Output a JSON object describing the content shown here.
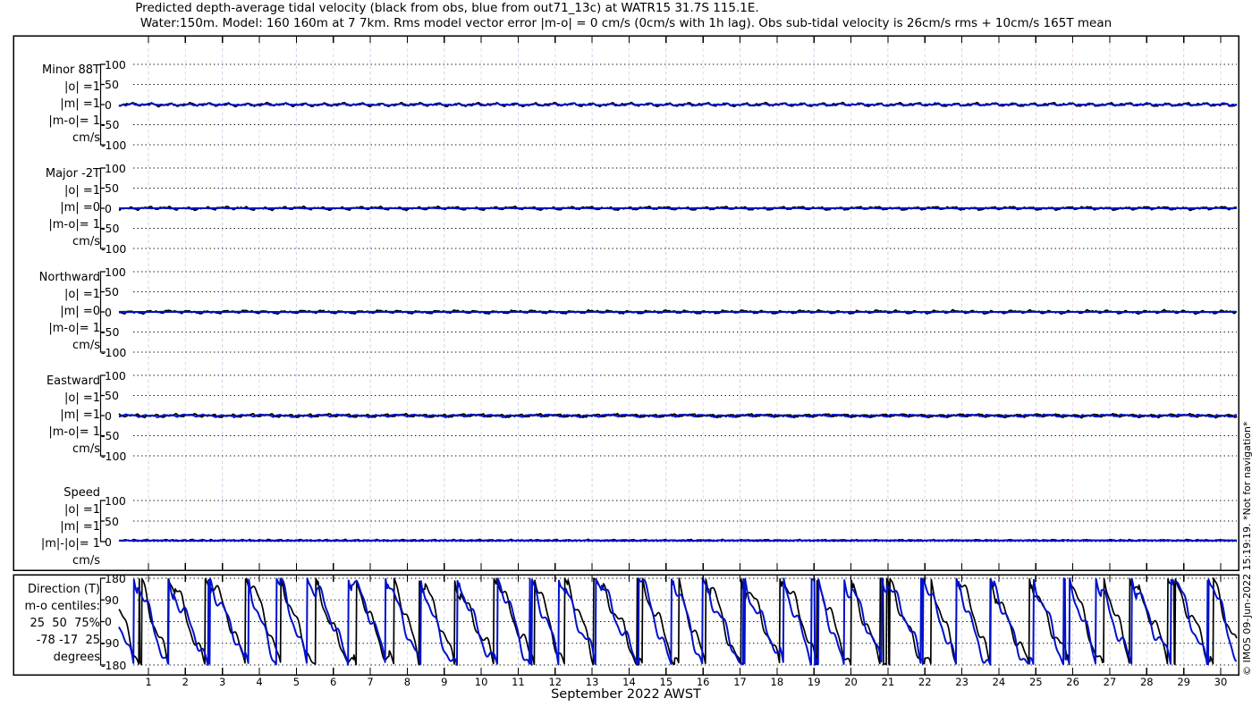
{
  "title": {
    "line1": "Predicted depth-average tidal velocity (black from obs, blue from out71_13c) at WATR15 31.7S 115.1E.",
    "line2": "Water:150m. Model: 160 160m at 7 7km. Rms model vector error |m-o| = 0 cm/s (0cm/s with 1h lag). Obs sub-tidal velocity is 26cm/s rms + 10cm/s 165T mean"
  },
  "watermark": "© IMOS 09-Jun-2022 15:19:19. *Not for navigation*",
  "colors": {
    "obs_line": "#000000",
    "model_line": "#0011cc",
    "day_grid_a": "#ccd4e8",
    "day_grid_b": "#ecd8d8",
    "dotted_grid": "#111111",
    "axis": "#000000"
  },
  "xaxis": {
    "label": "September 2022 AWST",
    "days": [
      "1",
      "2",
      "3",
      "4",
      "5",
      "6",
      "7",
      "8",
      "9",
      "10",
      "11",
      "12",
      "13",
      "14",
      "15",
      "16",
      "17",
      "18",
      "19",
      "20",
      "21",
      "22",
      "23",
      "24",
      "25",
      "26",
      "27",
      "28",
      "29",
      "30"
    ]
  },
  "panels": [
    {
      "id": "minor",
      "label_lines": [
        "Minor 88T",
        "|o| =1",
        "|m| =1",
        "|m-o|= 1",
        "cm/s"
      ],
      "yticks": [
        "100",
        "50",
        "0",
        "-50",
        "-100"
      ]
    },
    {
      "id": "major",
      "label_lines": [
        "Major -2T",
        "|o| =1",
        "|m| =0",
        "|m-o|= 1",
        "cm/s"
      ],
      "yticks": [
        "100",
        "50",
        "0",
        "-50",
        "-100"
      ]
    },
    {
      "id": "northward",
      "label_lines": [
        "Northward",
        "|o| =1",
        "|m| =0",
        "|m-o|= 1",
        "cm/s"
      ],
      "yticks": [
        "100",
        "50",
        "0",
        "-50",
        "-100"
      ]
    },
    {
      "id": "eastward",
      "label_lines": [
        "Eastward",
        "|o| =1",
        "|m| =1",
        "|m-o|= 1",
        "cm/s"
      ],
      "yticks": [
        "100",
        "50",
        "0",
        "-50",
        "-100"
      ]
    },
    {
      "id": "speed",
      "label_lines": [
        "Speed",
        "|o| =1",
        "|m| =1",
        "|m|-|o|= 1",
        "cm/s"
      ],
      "yticks": [
        "100",
        "50",
        "0"
      ]
    },
    {
      "id": "direction",
      "label_lines": [
        "Direction (T)",
        "m-o centiles:",
        "25  50  75%",
        "-78 -17  25",
        "degrees"
      ],
      "yticks": [
        "180",
        "90",
        "0",
        "-90",
        "-180"
      ]
    }
  ],
  "chart_data": {
    "type": "line",
    "title": "Predicted depth-average tidal velocity (black from obs, blue from out71_13c) at WATR15 31.7S 115.1E.",
    "subtitle": "Water:150m. Model: 160 160m at 7 7km. Rms model vector error |m-o| = 0 cm/s (0cm/s with 1h lag). Obs sub-tidal velocity is 26cm/s rms + 10cm/s 165T mean",
    "x_axis": {
      "label": "September 2022 AWST",
      "month": "September 2022",
      "timezone": "AWST",
      "tick_labels": [
        1,
        2,
        3,
        4,
        5,
        6,
        7,
        8,
        9,
        10,
        11,
        12,
        13,
        14,
        15,
        16,
        17,
        18,
        19,
        20,
        21,
        22,
        23,
        24,
        25,
        26,
        27,
        28,
        29,
        30
      ],
      "grid": "vertical dashed line per day, alternating pale blue / pale pink"
    },
    "legend": [
      {
        "name": "observations",
        "color": "#000000"
      },
      {
        "name": "model out71_13c",
        "color": "#0011cc"
      }
    ],
    "panels": [
      {
        "name": "Minor 88T",
        "units": "cm/s",
        "ylim": [
          -100,
          100
        ],
        "yticks": [
          100,
          50,
          0,
          -50,
          -100
        ],
        "obs_rms_cmps": 1,
        "model_rms_cmps": 1,
        "model_minus_obs_rms_cmps": 1,
        "appearance": "both traces essentially flat at 0 with ~±2 cm/s wiggles over the whole month"
      },
      {
        "name": "Major -2T",
        "units": "cm/s",
        "ylim": [
          -100,
          100
        ],
        "yticks": [
          100,
          50,
          0,
          -50,
          -100
        ],
        "obs_rms_cmps": 1,
        "model_rms_cmps": 0,
        "model_minus_obs_rms_cmps": 1,
        "appearance": "blue model trace flat at 0; black obs trace shows tiny ±2 cm/s blips"
      },
      {
        "name": "Northward",
        "units": "cm/s",
        "ylim": [
          -100,
          100
        ],
        "yticks": [
          100,
          50,
          0,
          -50,
          -100
        ],
        "obs_rms_cmps": 1,
        "model_rms_cmps": 0,
        "model_minus_obs_rms_cmps": 1,
        "appearance": "blue model trace flat at 0; black obs trace shows tiny ±2 cm/s blips"
      },
      {
        "name": "Eastward",
        "units": "cm/s",
        "ylim": [
          -100,
          100
        ],
        "yticks": [
          100,
          50,
          0,
          -50,
          -100
        ],
        "obs_rms_cmps": 1,
        "model_rms_cmps": 1,
        "model_minus_obs_rms_cmps": 1,
        "appearance": "both traces essentially flat at 0 with ~±2 cm/s wiggles"
      },
      {
        "name": "Speed",
        "units": "cm/s",
        "ylim": [
          0,
          100
        ],
        "yticks": [
          100,
          50,
          0
        ],
        "obs_rms_cmps": 1,
        "model_rms_cmps": 1,
        "abs_model_minus_abs_obs_rms_cmps": 1,
        "appearance": "both traces hug the 0 line, speed ~0-2 cm/s"
      },
      {
        "name": "Direction (T)",
        "units": "degrees",
        "ylim": [
          -180,
          180
        ],
        "yticks": [
          180,
          90,
          0,
          -90,
          -180
        ],
        "m_minus_o_centile_pcts": [
          25,
          50,
          75
        ],
        "m_minus_o_centiles_deg": [
          -78,
          -17,
          25
        ],
        "appearance": "black obs and blue model sawtooth traces, roughly one descending sweep per day from +180 wrapping through -180, traces loosely tracking each other all month"
      }
    ],
    "annotations": {
      "station": "WATR15",
      "position": "31.7S 115.1E",
      "water_depth": "150m",
      "model_grid": "160 160m at 7 7km",
      "rms_model_vector_error": "0 cm/s (0cm/s with 1h lag)",
      "obs_subtidal_velocity": "26cm/s rms + 10cm/s 165T mean",
      "watermark": "© IMOS 09-Jun-2022 15:19:19. *Not for navigation*"
    }
  }
}
